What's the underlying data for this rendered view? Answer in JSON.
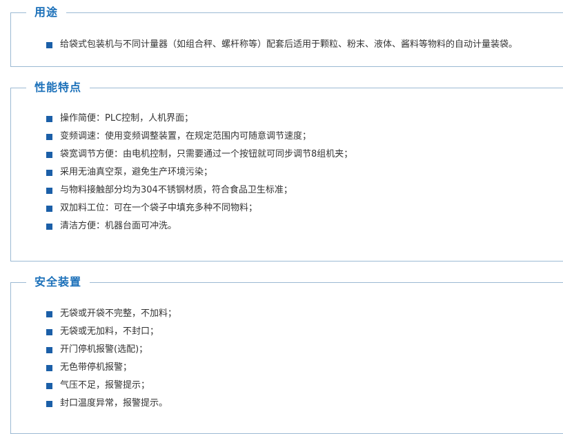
{
  "usage": {
    "title": "用途",
    "items": [
      "给袋式包装机与不同计量器（如组合秤、螺杆称等）配套后适用于颗粒、粉末、液体、酱料等物料的自动计量装袋。"
    ]
  },
  "features": {
    "title": "性能特点",
    "items": [
      "操作简便：PLC控制，人机界面；",
      "变频调速：使用变频调整装置，在规定范围内可随意调节速度；",
      "袋宽调节方便：由电机控制，只需要通过一个按钮就可同步调节8组机夹；",
      "采用无油真空泵，避免生产环境污染；",
      "与物料接触部分均为304不锈钢材质，符合食品卫生标准；",
      "双加料工位：可在一个袋子中填充多种不同物料；",
      "清洁方便：机器台面可冲洗。"
    ]
  },
  "safety": {
    "title": "安全装置",
    "items": [
      "无袋或开袋不完整，不加料；",
      "无袋或无加料，不封口；",
      "开门停机报警(选配)；",
      "无色带停机报警；",
      "气压不足，报警提示；",
      "封口温度异常，报警提示。"
    ]
  },
  "colors": {
    "title": "#1b70b9",
    "border": "#9bb9d3",
    "bullet": "#1b5fa8",
    "text": "#333333"
  }
}
